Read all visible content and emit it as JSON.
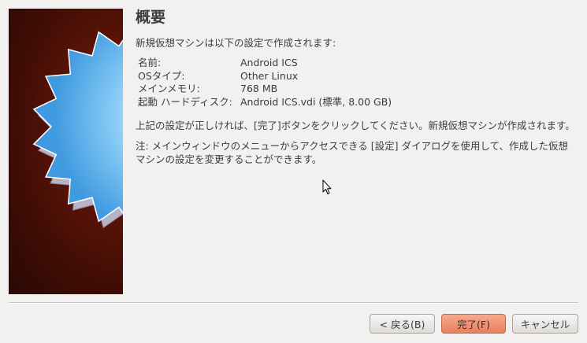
{
  "wizard": {
    "title": "概要",
    "intro": "新規仮想マシンは以下の設定で作成されます:",
    "summary": [
      {
        "key": "名前:",
        "value": "Android ICS"
      },
      {
        "key": "OSタイプ:",
        "value": "Other Linux"
      },
      {
        "key": "メインメモリ:",
        "value": "768 MB"
      },
      {
        "key": "起動 ハードディスク:",
        "value": "Android ICS.vdi (標準, 8.00 GB)"
      }
    ],
    "paragraph1": "上記の設定が正しければ、[完了]ボタンをクリックしてください。新規仮想マシンが作成されます。",
    "paragraph2": "注: メインウィンドウのメニューからアクセスできる [設定] ダイアログを使用して、作成した仮想マシンの設定を変更することができます。"
  },
  "buttons": {
    "back": "< 戻る(B)",
    "finish": "完了(F)",
    "cancel": "キャンセル"
  },
  "colors": {
    "accent_button": "#f08c6a",
    "banner_dark_red": "#5c1408",
    "star_blue": "#7ec8f5"
  }
}
